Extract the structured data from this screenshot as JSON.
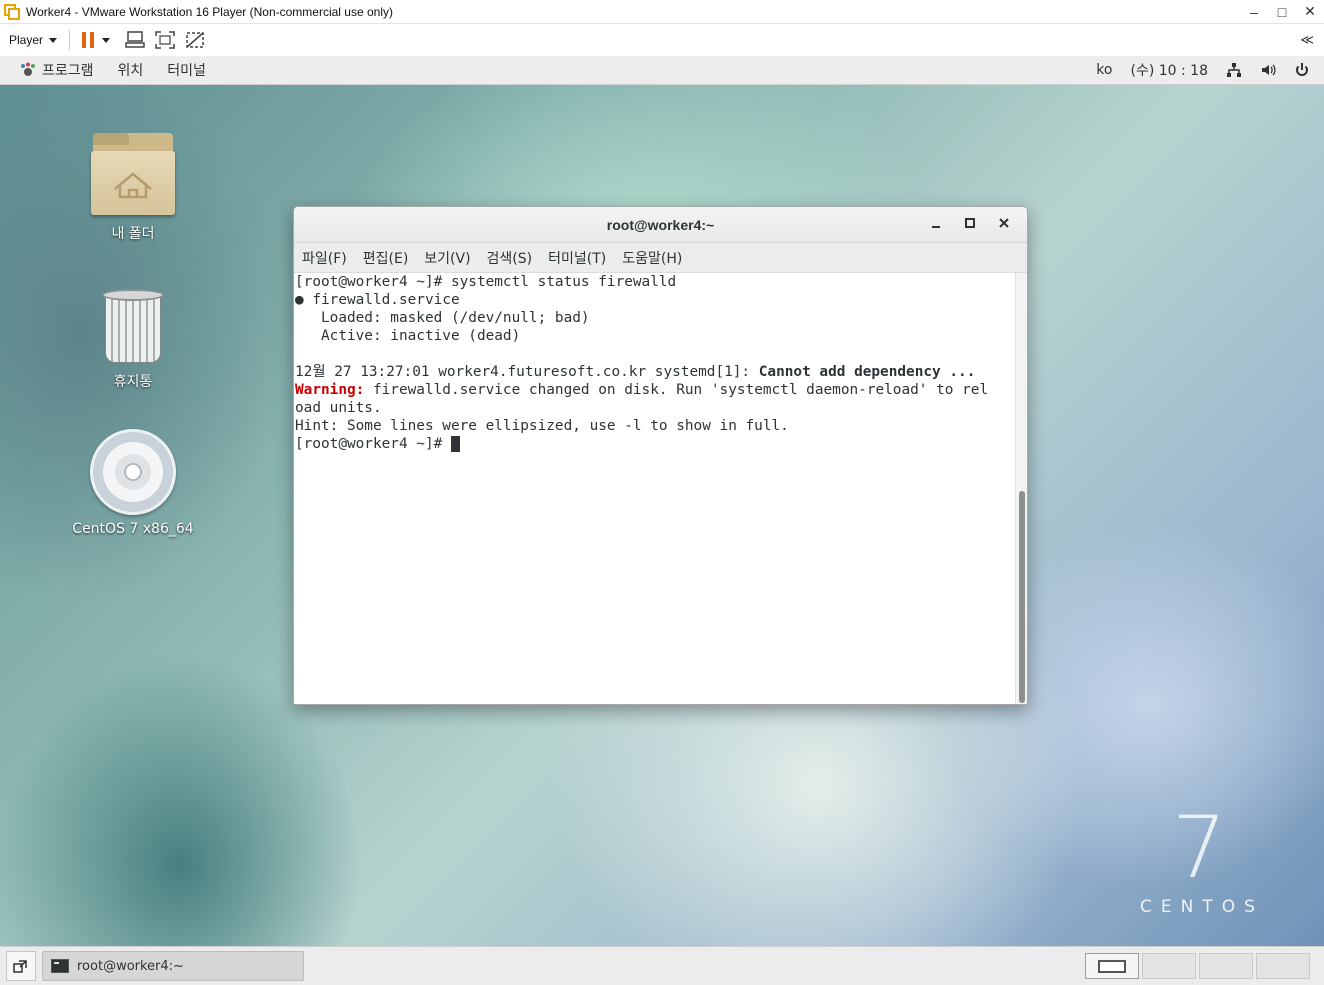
{
  "vmware": {
    "title": "Worker4 - VMware Workstation 16 Player (Non-commercial use only)",
    "player_label": "Player",
    "window_controls": {
      "minimize": "–",
      "maximize": "□",
      "close": "✕"
    },
    "collapse": "≪"
  },
  "gnome_panel": {
    "menu_items": [
      "프로그램",
      "위치",
      "터미널"
    ],
    "lang": "ko",
    "clock": "(수) 10 : 18"
  },
  "desktop": {
    "icons": [
      {
        "label": "내 폴더",
        "icon": "home-folder-icon"
      },
      {
        "label": "휴지통",
        "icon": "trash-icon"
      },
      {
        "label": "CentOS 7 x86_64",
        "icon": "optical-disc-icon"
      }
    ],
    "watermark": {
      "numeral": "7",
      "text": "CENTOS"
    }
  },
  "terminal": {
    "title": "root@worker4:~",
    "menu": [
      "파일(F)",
      "편집(E)",
      "보기(V)",
      "검색(S)",
      "터미널(T)",
      "도움말(H)"
    ],
    "lines": {
      "l1": "[root@worker4 ~]# systemctl status firewalld",
      "l2": "● firewalld.service",
      "l3": "   Loaded: masked (/dev/null; bad)",
      "l4": "   Active: inactive (dead)",
      "l5": "",
      "l6_prefix": "12월 27 13:27:01 worker4.futuresoft.co.kr systemd[1]: ",
      "l6_bold": "Cannot add dependency ...",
      "l7_warn": "Warning:",
      "l7_rest": " firewalld.service changed on disk. Run 'systemctl daemon-reload' to rel",
      "l8": "oad units.",
      "l9": "Hint: Some lines were ellipsized, use -l to show in full.",
      "l10": "[root@worker4 ~]# "
    }
  },
  "taskbar": {
    "task_label": "root@worker4:~",
    "workspace_count": 4
  },
  "colors": {
    "pause_orange": "#e8620f",
    "warning_red": "#cc0000",
    "terminal_text": "#2e3436"
  }
}
